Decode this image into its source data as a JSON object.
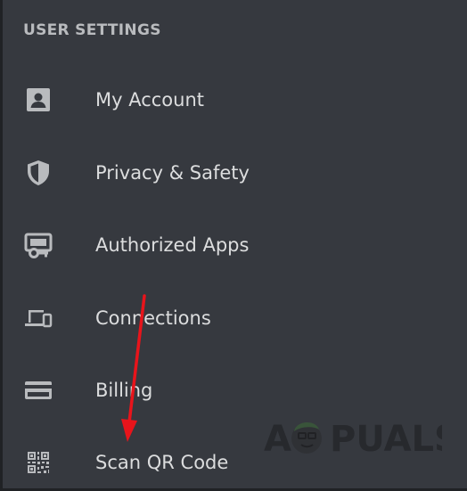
{
  "section": {
    "title": "USER SETTINGS"
  },
  "menu": {
    "items": [
      {
        "label": "My Account",
        "icon": "account-card-icon"
      },
      {
        "label": "Privacy & Safety",
        "icon": "shield-icon"
      },
      {
        "label": "Authorized Apps",
        "icon": "authorized-apps-icon"
      },
      {
        "label": "Connections",
        "icon": "devices-icon"
      },
      {
        "label": "Billing",
        "icon": "credit-card-icon"
      },
      {
        "label": "Scan QR Code",
        "icon": "qr-code-icon"
      }
    ]
  },
  "annotation": {
    "color": "#e8141b"
  },
  "watermark": {
    "text": "APPUALS"
  },
  "colors": {
    "background": "#36393f",
    "text": "#dcddde",
    "header": "#b9bbbe",
    "icon": "#b9bbbe"
  }
}
